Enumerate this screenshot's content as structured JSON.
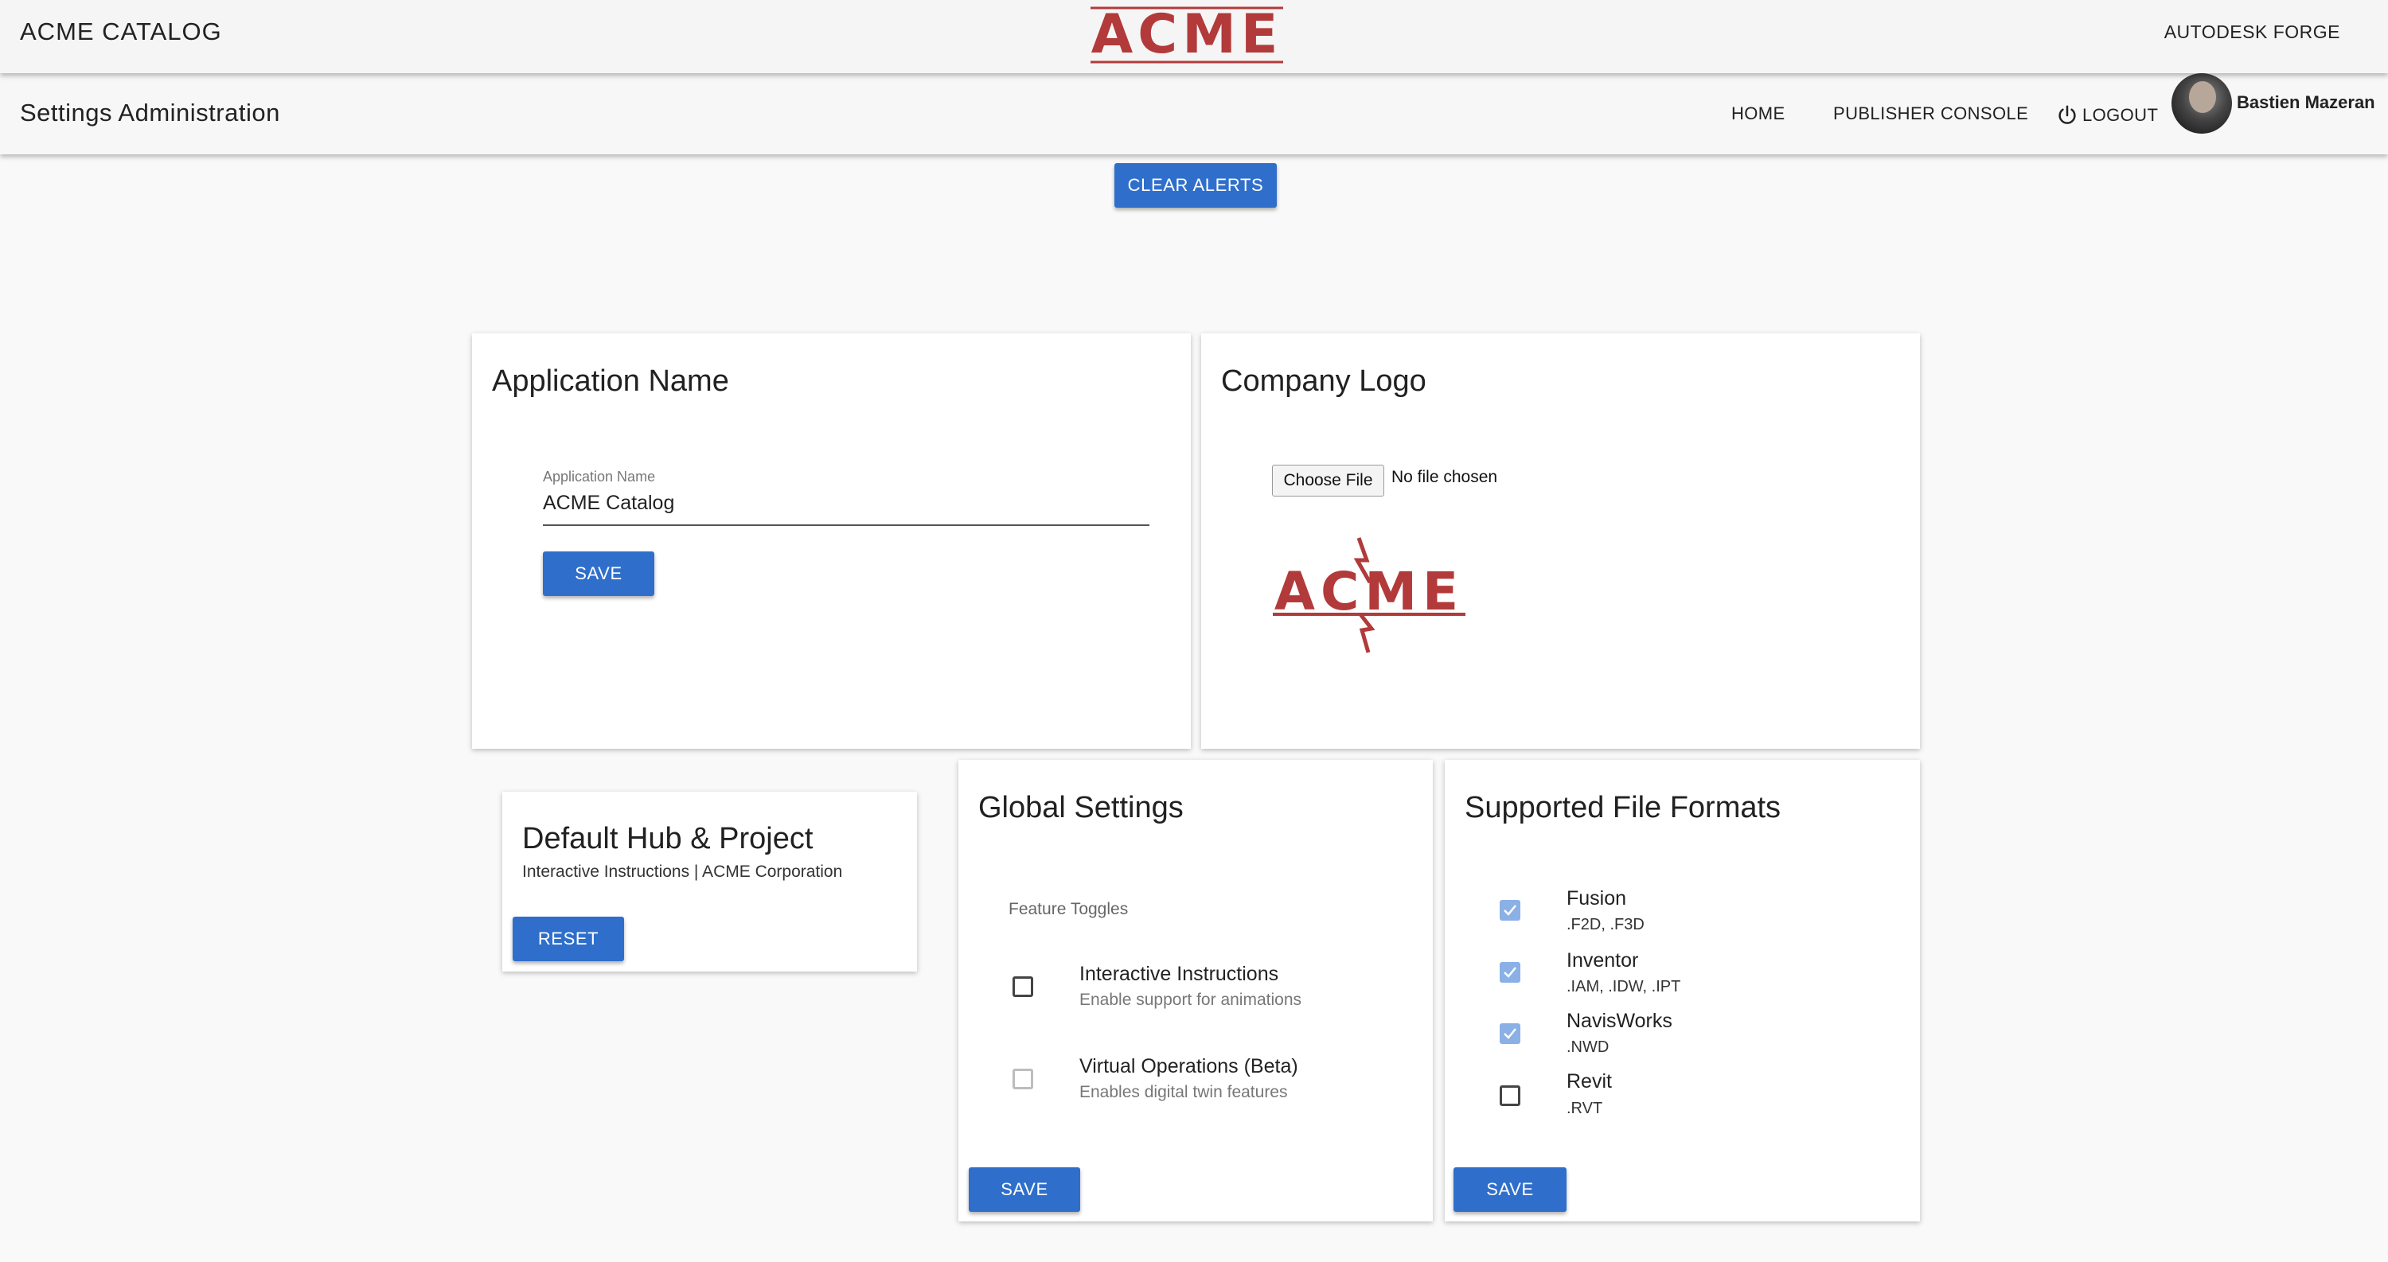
{
  "header": {
    "app_title": "ACME CATALOG",
    "logo_text": "ACME",
    "forge_link": "AUTODESK FORGE"
  },
  "subheader": {
    "page_title": "Settings Administration",
    "nav": {
      "home": "HOME",
      "publisher": "PUBLISHER CONSOLE",
      "logout": "LOGOUT"
    },
    "user_name": "Bastien Mazeran"
  },
  "alerts": {
    "clear_label": "CLEAR ALERTS"
  },
  "app_name_card": {
    "title": "Application Name",
    "field_label": "Application Name",
    "field_value": "ACME Catalog",
    "save_label": "SAVE"
  },
  "logo_card": {
    "title": "Company Logo",
    "choose_file": "Choose File",
    "file_status": "No file chosen",
    "logo_text": "ACME"
  },
  "hub_card": {
    "title": "Default Hub & Project",
    "subtitle": "Interactive Instructions | ACME Corporation",
    "reset_label": "RESET"
  },
  "global_card": {
    "title": "Global Settings",
    "toggles_label": "Feature Toggles",
    "options": [
      {
        "label": "Interactive Instructions",
        "sub": "Enable support for animations",
        "checked": false
      },
      {
        "label": "Virtual Operations (Beta)",
        "sub": "Enables digital twin features",
        "checked": false
      }
    ],
    "save_label": "SAVE"
  },
  "formats_card": {
    "title": "Supported File Formats",
    "formats": [
      {
        "label": "Fusion",
        "ext": ".F2D, .F3D",
        "checked": true
      },
      {
        "label": "Inventor",
        "ext": ".IAM, .IDW, .IPT",
        "checked": true
      },
      {
        "label": "NavisWorks",
        "ext": ".NWD",
        "checked": true
      },
      {
        "label": "Revit",
        "ext": ".RVT",
        "checked": false
      }
    ],
    "save_label": "SAVE"
  },
  "colors": {
    "primary": "#2f6fcb",
    "logo_red": "#b23a3a",
    "checked": "#8ab0e6"
  }
}
